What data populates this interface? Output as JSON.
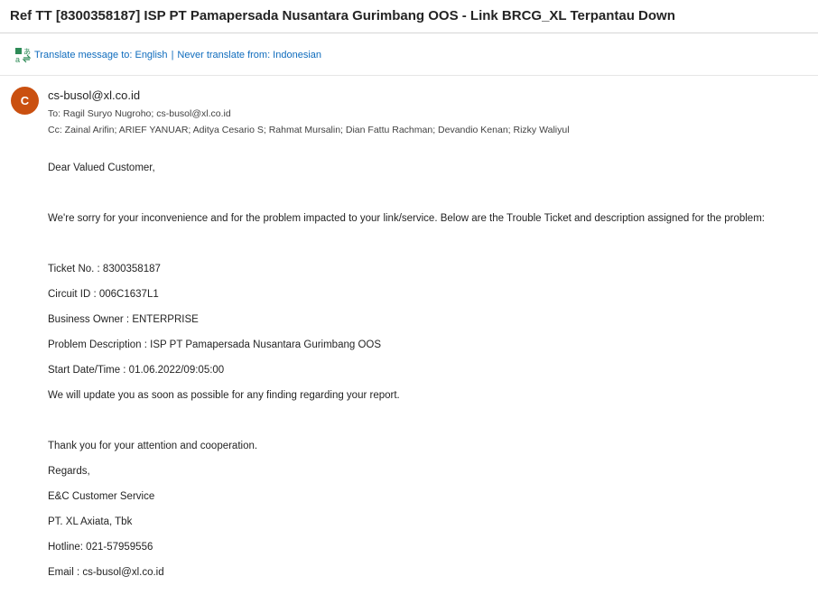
{
  "subject": "Ref TT [8300358187] ISP PT Pamapersada Nusantara Gurimbang OOS - Link BRCG_XL Terpantau Down",
  "translate": {
    "icon": "translate-icon",
    "translate_label": "Translate message to: English",
    "divider": "|",
    "never_label": "Never translate from: Indonesian"
  },
  "sender": {
    "avatar_letter": "C",
    "avatar_color": "#ca5010",
    "from": "cs-busol@xl.co.id",
    "to": "To:  Ragil Suryo Nugroho;  cs-busol@xl.co.id",
    "cc": "Cc:  Zainal Arifin;  ARIEF YANUAR;  Aditya Cesario S;  Rahmat Mursalin;  Dian Fattu Rachman;  Devandio Kenan;  Rizky Waliyul"
  },
  "body": {
    "greeting": "Dear Valued Customer,",
    "intro": "We're sorry for your inconvenience and for the problem impacted to your link/service. Below are the Trouble Ticket and description assigned for the problem:",
    "ticket": "Ticket No. : 8300358187",
    "circuit": "Circuit ID : 006C1637L1",
    "owner": "Business Owner : ENTERPRISE",
    "problem": "Problem Description : ISP PT Pamapersada Nusantara Gurimbang OOS",
    "start": "Start Date/Time : 01.06.2022/09:05:00",
    "update": "We will update you as soon as possible for any finding regarding your report.",
    "thanks": "Thank you for your attention and cooperation.",
    "regards": "Regards,",
    "team": "E&C Customer Service",
    "company": "PT. XL Axiata, Tbk",
    "hotline": "Hotline: 021-57959556",
    "email": "Email : cs-busol@xl.co.id"
  }
}
